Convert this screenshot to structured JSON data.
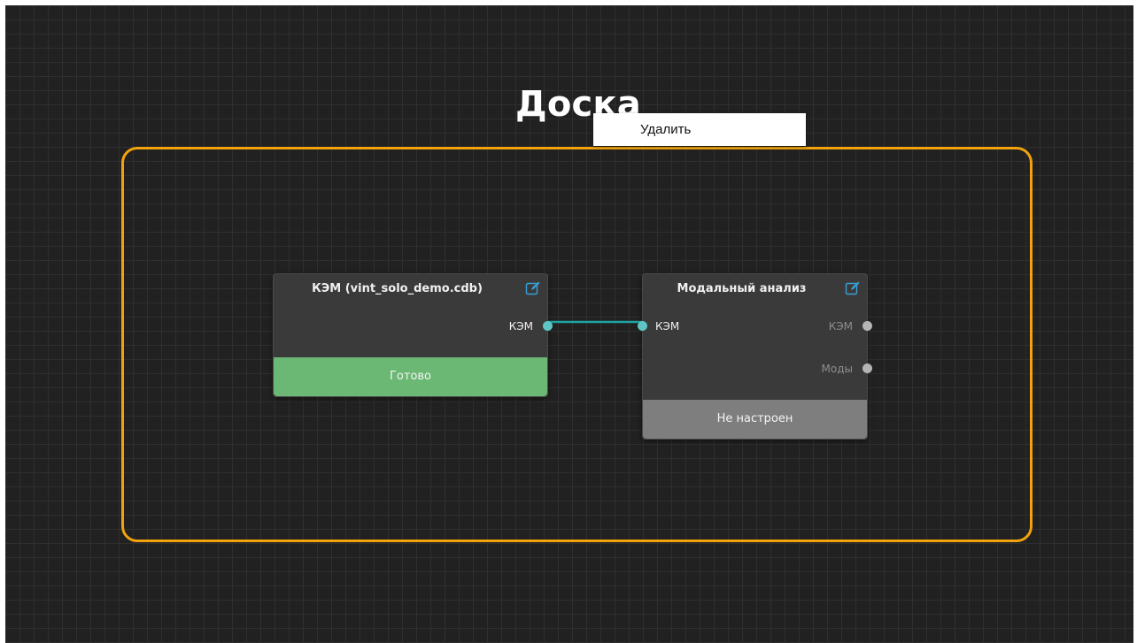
{
  "board": {
    "title": "Доска"
  },
  "context_menu": {
    "items": [
      {
        "label": "Удалить"
      }
    ]
  },
  "colors": {
    "canvas_bg": "#212121",
    "grid_line": "#2f2f2f",
    "group_frame": "#f2a20c",
    "status_ready": "#6ab873",
    "status_not_configured": "#7e7e7e",
    "port_active": "#5fc4c4",
    "port_inactive": "#b5b5b5",
    "connection": "#1fa3a3",
    "edit_icon": "#3a9fd6"
  },
  "nodes": [
    {
      "title": "КЭМ (vint_solo_demo.cdb)",
      "edit_icon": "edit-icon",
      "outputs": [
        {
          "label": "КЭМ",
          "active": true
        }
      ],
      "status": "Готово"
    },
    {
      "title": "Модальный анализ",
      "edit_icon": "edit-icon",
      "inputs": [
        {
          "label": "КЭМ",
          "active": true
        }
      ],
      "outputs": [
        {
          "label": "КЭМ",
          "active": false
        },
        {
          "label": "Моды",
          "active": false
        }
      ],
      "status": "Не настроен"
    }
  ]
}
